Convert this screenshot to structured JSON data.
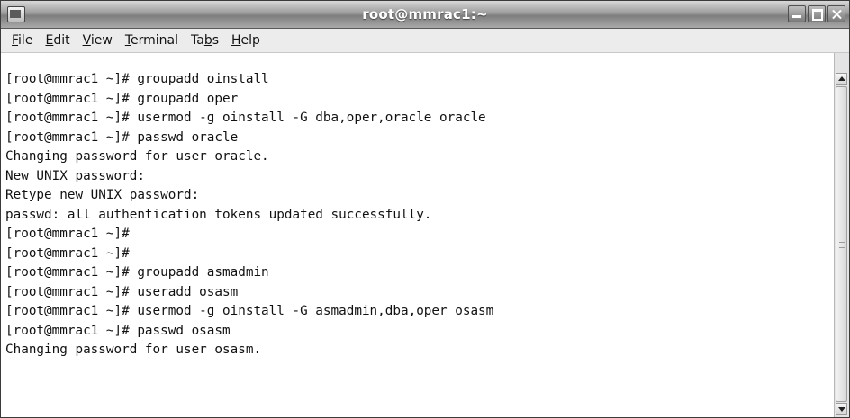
{
  "window": {
    "title": "root@mmrac1:~"
  },
  "menubar": {
    "items": [
      {
        "mnemonic": "F",
        "rest": "ile"
      },
      {
        "mnemonic": "E",
        "rest": "dit"
      },
      {
        "mnemonic": "V",
        "rest": "iew"
      },
      {
        "mnemonic": "T",
        "rest": "erminal"
      },
      {
        "pre": "Ta",
        "mnemonic": "b",
        "rest": "s"
      },
      {
        "mnemonic": "H",
        "rest": "elp"
      }
    ]
  },
  "terminal": {
    "lines": [
      "[root@mmrac1 ~]# groupadd oinstall",
      "[root@mmrac1 ~]# groupadd oper",
      "[root@mmrac1 ~]# usermod -g oinstall -G dba,oper,oracle oracle",
      "[root@mmrac1 ~]# passwd oracle",
      "Changing password for user oracle.",
      "New UNIX password:",
      "Retype new UNIX password:",
      "passwd: all authentication tokens updated successfully.",
      "[root@mmrac1 ~]#",
      "[root@mmrac1 ~]#",
      "[root@mmrac1 ~]# groupadd asmadmin",
      "[root@mmrac1 ~]# useradd osasm",
      "[root@mmrac1 ~]# usermod -g oinstall -G asmadmin,dba,oper osasm",
      "[root@mmrac1 ~]# passwd osasm",
      "Changing password for user osasm."
    ]
  },
  "icons": {
    "window_icon": "terminal-window-icon",
    "minimize": "minimize-icon",
    "maximize": "maximize-icon",
    "close": "close-icon",
    "scroll_up": "arrow-up-icon",
    "scroll_down": "arrow-down-icon"
  }
}
